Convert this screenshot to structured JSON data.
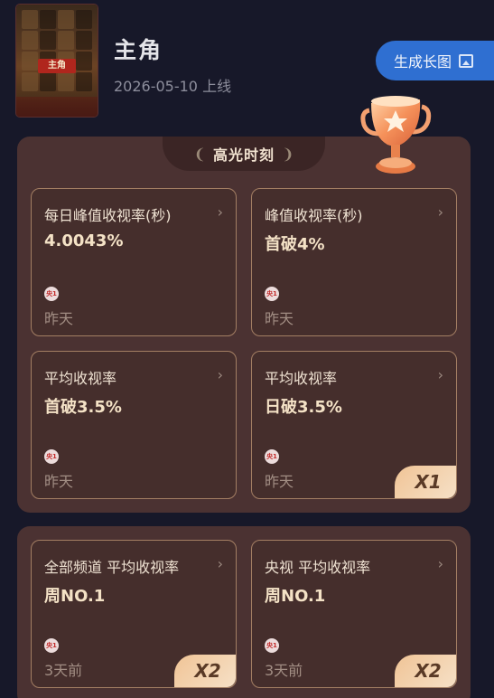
{
  "show": {
    "title": "主角",
    "release": "2026-05-10 上线",
    "poster_logo": "主角"
  },
  "actions": {
    "generate_label": "生成长图"
  },
  "highlight": {
    "banner": "高光时刻",
    "cards": [
      {
        "metric": "每日峰值收视率(秒)",
        "value": "4.0043%",
        "channel": "央1",
        "time": "昨天"
      },
      {
        "metric": "峰值收视率(秒)",
        "value": "首破4%",
        "channel": "央1",
        "time": "昨天"
      },
      {
        "metric": "平均收视率",
        "value": "首破3.5%",
        "channel": "央1",
        "time": "昨天"
      },
      {
        "metric": "平均收视率",
        "value": "日破3.5%",
        "channel": "央1",
        "time": "昨天",
        "badge": "X1"
      }
    ]
  },
  "ranking": {
    "cards": [
      {
        "metric": "全部频道 平均收视率",
        "value": "周NO.1",
        "channel": "央1",
        "time": "3天前",
        "badge": "X2"
      },
      {
        "metric": "央视 平均收视率",
        "value": "周NO.1",
        "channel": "央1",
        "time": "3天前",
        "badge": "X2"
      }
    ]
  },
  "colors": {
    "background": "#171829",
    "panel": "#4b3232",
    "button": "#2f6fd1",
    "value_text": "#f4e2c6"
  },
  "icons": {
    "chevron": "›",
    "laurel_left": "❨",
    "laurel_right": "❩"
  }
}
